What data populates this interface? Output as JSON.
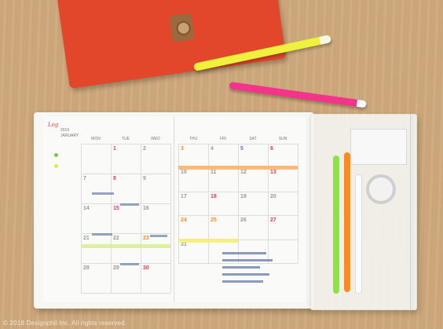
{
  "photo": {
    "caption": "© 2018 Designphil Inc. All rights reserved."
  },
  "planner": {
    "brand_logo": "Log",
    "year": "2019",
    "month": "JANUARY",
    "weekday_headers_left": [
      "MON",
      "TUE",
      "WED"
    ],
    "weekday_headers_right": [
      "THU",
      "FRI",
      "SAT",
      "SUN"
    ],
    "left_page_dates": [
      [
        "",
        "1",
        "2"
      ],
      [
        "7",
        "8",
        "9"
      ],
      [
        "14",
        "15",
        "16"
      ],
      [
        "21",
        "22",
        "23"
      ],
      [
        "28",
        "29",
        "30"
      ]
    ],
    "right_page_dates": [
      [
        "3",
        "4",
        "5",
        "6"
      ],
      [
        "10",
        "11",
        "12",
        "13"
      ],
      [
        "17",
        "18",
        "19",
        "20"
      ],
      [
        "24",
        "25",
        "26",
        "27"
      ],
      [
        "31",
        "",
        "",
        ""
      ]
    ]
  },
  "colors": {
    "cover": "#e2462b",
    "strap": "#9a6a3e",
    "pen_yellow": "#eef23c",
    "pen_pink": "#f4338a",
    "pen_green": "#8fe04a",
    "pen_orange": "#ff8a1e",
    "highlight_orange": "#ffb36b",
    "highlight_yellow": "#f2f26a",
    "date_red": "#e8384f",
    "date_orange": "#ff8a1e"
  }
}
